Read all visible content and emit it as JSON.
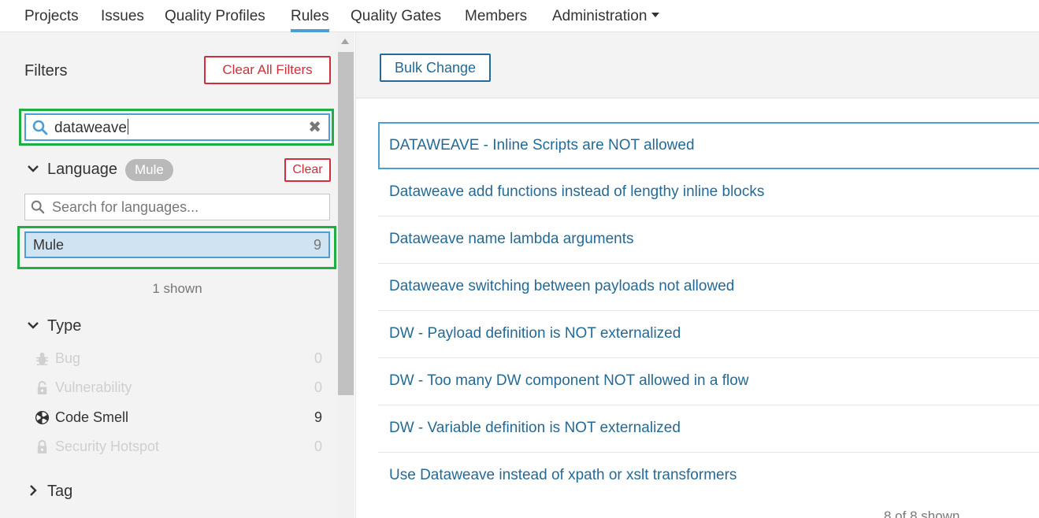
{
  "nav": {
    "items": [
      "Projects",
      "Issues",
      "Quality Profiles",
      "Rules",
      "Quality Gates",
      "Members",
      "Administration"
    ],
    "active": "Rules"
  },
  "sidebar": {
    "title": "Filters",
    "clear_all_label": "Clear All Filters",
    "search": {
      "value": "dataweave"
    },
    "language": {
      "heading": "Language",
      "selected_badge": "Mule",
      "clear_label": "Clear",
      "search_placeholder": "Search for languages...",
      "items": [
        {
          "name": "Mule",
          "count": "9",
          "selected": true
        }
      ],
      "shown_text": "1 shown"
    },
    "type": {
      "heading": "Type",
      "items": [
        {
          "name": "Bug",
          "count": "0",
          "icon": "bug-icon",
          "enabled": false
        },
        {
          "name": "Vulnerability",
          "count": "0",
          "icon": "lock-icon",
          "enabled": false
        },
        {
          "name": "Code Smell",
          "count": "9",
          "icon": "code-smell-icon",
          "enabled": true
        },
        {
          "name": "Security Hotspot",
          "count": "0",
          "icon": "lock-icon",
          "enabled": false
        }
      ]
    },
    "tag": {
      "heading": "Tag"
    }
  },
  "main": {
    "bulk_change_label": "Bulk Change",
    "rules": [
      "DATAWEAVE - Inline Scripts are NOT allowed",
      "Dataweave add functions instead of lengthy inline blocks",
      "Dataweave name lambda arguments",
      "Dataweave switching between payloads not allowed",
      "DW - Payload definition is NOT externalized",
      "DW - Too many DW component NOT allowed in a flow",
      "DW - Variable definition is NOT externalized",
      "Use Dataweave instead of xpath or xslt transformers"
    ],
    "footer_text": "8 of 8 shown"
  },
  "colors": {
    "accent": "#4b9fd5",
    "link": "#236a97",
    "danger": "#d02f3a",
    "highlight_green": "#1fad44"
  }
}
